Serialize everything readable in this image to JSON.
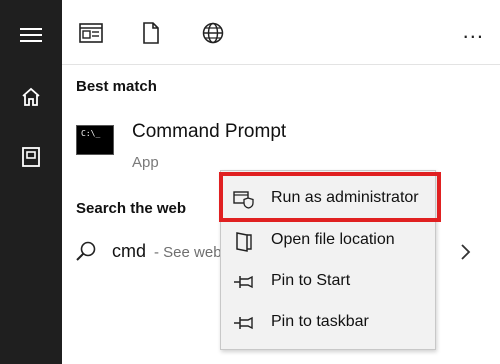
{
  "rail": {
    "icons": [
      "hamburger-menu-icon",
      "home-icon",
      "documents-icon"
    ]
  },
  "toolbar": {
    "icons": [
      "apps-icon",
      "document-icon",
      "globe-icon"
    ],
    "more_label": "..."
  },
  "best_match": {
    "title": "Best match",
    "app_name": "Command Prompt",
    "app_type": "App",
    "icon_text": "C:\\_"
  },
  "search_web": {
    "title": "Search the web",
    "query": "cmd",
    "hint": "- See web"
  },
  "context_menu": {
    "items": [
      {
        "label": "Run as administrator",
        "icon": "shield-run-icon"
      },
      {
        "label": "Open file location",
        "icon": "folder-icon"
      },
      {
        "label": "Pin to Start",
        "icon": "pin-icon"
      },
      {
        "label": "Pin to taskbar",
        "icon": "pin-icon"
      }
    ]
  },
  "colors": {
    "rail": "#1f1f1f",
    "highlight": "#e02021",
    "menu_bg": "#f2f2f2"
  }
}
